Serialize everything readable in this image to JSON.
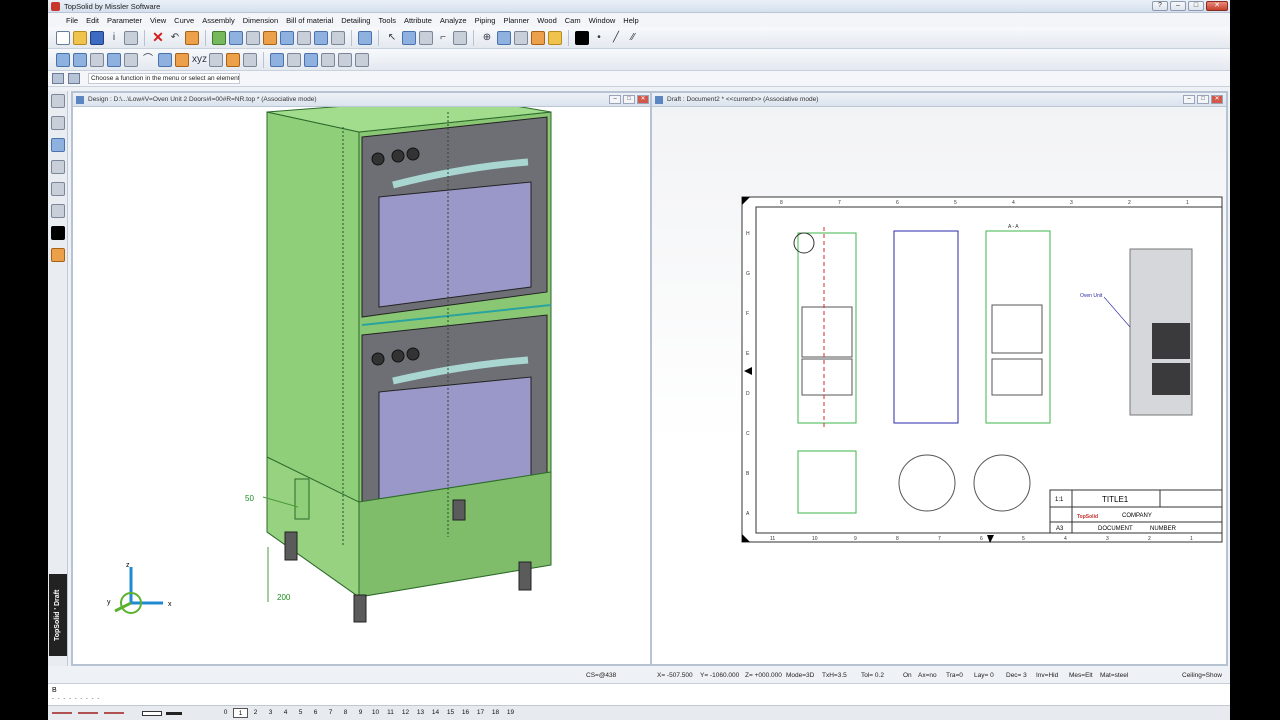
{
  "app": {
    "title": "TopSolid by Missler Software",
    "brand": "TopSolid ' Draft"
  },
  "menu": [
    "File",
    "Edit",
    "Parameter",
    "View",
    "Curve",
    "Assembly",
    "Dimension",
    "Bill of material",
    "Detailing",
    "Tools",
    "Attribute",
    "Analyze",
    "Piping",
    "Planner",
    "Wood",
    "Cam",
    "Window",
    "Help"
  ],
  "prompt": "Choose a function in the menu or select an element",
  "design_window": {
    "title": "Design : D:\\...\\Low#V=Oven Unit 2 Doors#I=00#R=NR.top  * (Associative mode)",
    "dim_50": "50",
    "dim_200": "200",
    "axes": {
      "x": "x",
      "y": "y",
      "z": "z"
    }
  },
  "draft_window": {
    "title": "Draft : Document2 *  <<current>> (Associative mode)",
    "label_oven_unit": "Oven Unit",
    "section_aa": "A - A",
    "title_block": {
      "scale": "1:1",
      "title": "TITLE1",
      "company": "COMPANY",
      "format": "A3",
      "document": "DOCUMENT",
      "number": "NUMBER",
      "logo": "TopSolid"
    },
    "border_numbers_top": [
      "8",
      "7",
      "6",
      "5",
      "4",
      "3",
      "2",
      "1"
    ],
    "border_numbers_bottom": [
      "11",
      "10",
      "9",
      "8",
      "7",
      "6",
      "5",
      "4",
      "3",
      "2",
      "1"
    ],
    "border_letters": [
      "H",
      "G",
      "F",
      "E",
      "D",
      "C",
      "B",
      "A"
    ]
  },
  "status": {
    "cs": "CS=@438",
    "x": "X= -507.500",
    "y": "Y= -1060.000",
    "z": "Z= +000.000",
    "mode": "Mode=3D",
    "txh": "TxH=3.5",
    "tol": "Tol=  0.2",
    "on": "On",
    "ax": "Ax=no",
    "tra": "Tra=0",
    "lay": "Lay= 0",
    "dec": "Dec= 3",
    "inv": "Inv=Hid",
    "mes": "Mes=Elt",
    "mat": "Mat=steel",
    "ceiling": "Ceiling=Show"
  },
  "command": {
    "text": "B",
    "dashes": "- - - - - - - - -"
  },
  "layers": [
    "0",
    "1",
    "2",
    "3",
    "4",
    "5",
    "6",
    "7",
    "8",
    "9",
    "10",
    "11",
    "12",
    "13",
    "14",
    "15",
    "16",
    "17",
    "18",
    "19"
  ],
  "colors": {
    "cabinet_green": "#8fcf7a",
    "oven_gray": "#6e6f74",
    "glass": "#9a98c9",
    "handle": "#a9d6d0"
  }
}
